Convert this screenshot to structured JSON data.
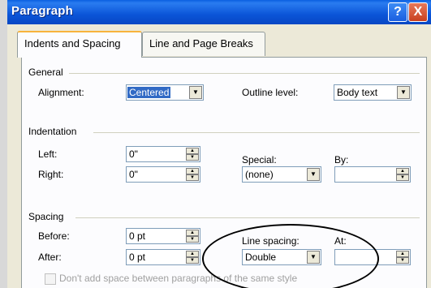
{
  "dialog": {
    "title": "Paragraph",
    "help_glyph": "?",
    "close_glyph": "X"
  },
  "tabs": [
    {
      "label": "Indents and Spacing",
      "active": true
    },
    {
      "label": "Line and Page Breaks",
      "active": false
    }
  ],
  "general": {
    "heading": "General",
    "alignment_label": "Alignment:",
    "alignment_value": "Centered",
    "outline_label": "Outline level:",
    "outline_value": "Body text"
  },
  "indentation": {
    "heading": "Indentation",
    "left_label": "Left:",
    "left_value": "0\"",
    "right_label": "Right:",
    "right_value": "0\"",
    "special_label": "Special:",
    "special_value": "(none)",
    "by_label": "By:",
    "by_value": ""
  },
  "spacing": {
    "heading": "Spacing",
    "before_label": "Before:",
    "before_value": "0 pt",
    "after_label": "After:",
    "after_value": "0 pt",
    "line_spacing_label": "Line spacing:",
    "line_spacing_value": "Double",
    "at_label": "At:",
    "at_value": "",
    "dont_add_space_label": "Don't add space between paragraphs of the same style"
  },
  "colors": {
    "titlebar": "#0b55d8",
    "selection": "#316ac5",
    "tab_highlight": "#f8b33c"
  }
}
